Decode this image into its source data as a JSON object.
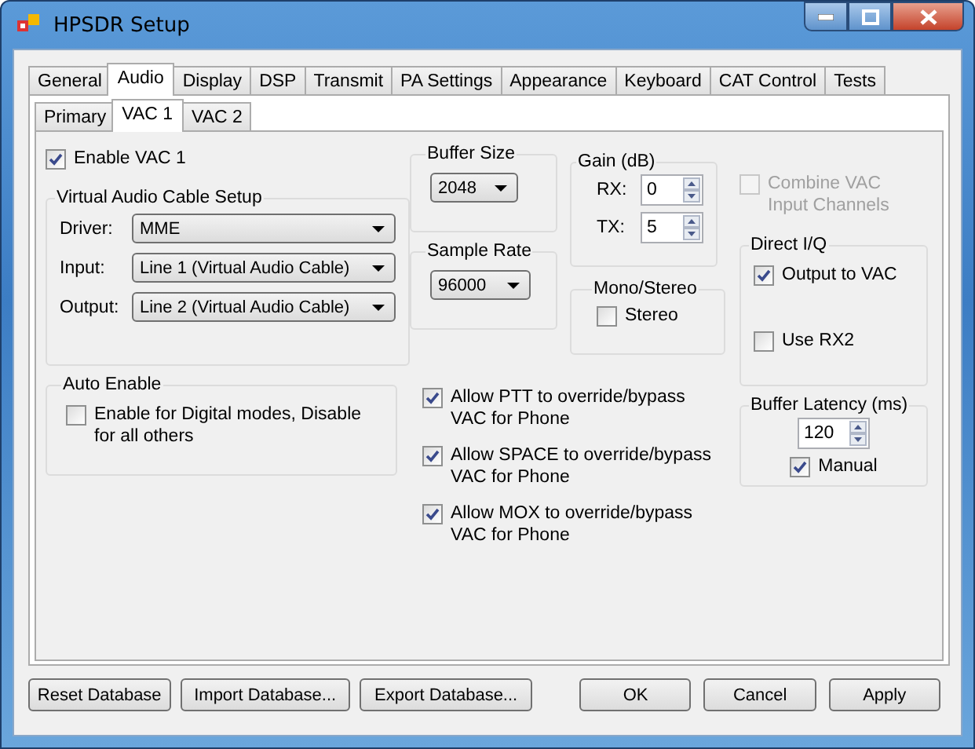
{
  "window": {
    "title": "HPSDR Setup"
  },
  "tabs": [
    {
      "label": "General",
      "selected": false
    },
    {
      "label": "Audio",
      "selected": true
    },
    {
      "label": "Display",
      "selected": false
    },
    {
      "label": "DSP",
      "selected": false
    },
    {
      "label": "Transmit",
      "selected": false
    },
    {
      "label": "PA Settings",
      "selected": false
    },
    {
      "label": "Appearance",
      "selected": false
    },
    {
      "label": "Keyboard",
      "selected": false
    },
    {
      "label": "CAT Control",
      "selected": false
    },
    {
      "label": "Tests",
      "selected": false
    }
  ],
  "subtabs": [
    {
      "label": "Primary",
      "selected": false
    },
    {
      "label": "VAC 1",
      "selected": true
    },
    {
      "label": "VAC 2",
      "selected": false
    }
  ],
  "enable_vac": {
    "label": "Enable VAC 1",
    "checked": true
  },
  "vac_setup": {
    "title": "Virtual Audio Cable Setup",
    "fields": [
      {
        "label": "Driver:",
        "value": "MME"
      },
      {
        "label": "Input:",
        "value": "Line 1 (Virtual Audio Cable)"
      },
      {
        "label": "Output:",
        "value": "Line 2 (Virtual Audio Cable)"
      }
    ]
  },
  "auto_enable": {
    "title": "Auto Enable",
    "checkbox": {
      "label": "Enable for Digital modes, Disable for all others",
      "checked": false
    }
  },
  "buffer_size": {
    "title": "Buffer Size",
    "value": "2048"
  },
  "sample_rate": {
    "title": "Sample Rate",
    "value": "96000"
  },
  "gain": {
    "title": "Gain (dB)",
    "rows": [
      {
        "label": "RX:",
        "value": "0"
      },
      {
        "label": "TX:",
        "value": "5"
      }
    ]
  },
  "mono_stereo": {
    "title": "Mono/Stereo",
    "checkbox": {
      "label": "Stereo",
      "checked": false
    }
  },
  "combine_vac": {
    "label": "Combine VAC Input Channels",
    "checked": false,
    "disabled": true
  },
  "direct_iq": {
    "title": "Direct I/Q",
    "checkboxes": [
      {
        "label": "Output to VAC",
        "checked": true
      },
      {
        "label": "Use RX2",
        "checked": false
      }
    ]
  },
  "allow_options": [
    {
      "label": "Allow PTT to override/bypass VAC for Phone",
      "checked": true
    },
    {
      "label": "Allow SPACE to override/bypass VAC for Phone",
      "checked": true
    },
    {
      "label": "Allow MOX to override/bypass VAC for Phone",
      "checked": true
    }
  ],
  "buffer_latency": {
    "title": "Buffer Latency (ms)",
    "value": "120",
    "manual": {
      "label": "Manual",
      "checked": true
    }
  },
  "buttons": [
    {
      "label": "Reset Database"
    },
    {
      "label": "Import Database..."
    },
    {
      "label": "Export Database..."
    },
    {
      "label": "OK"
    },
    {
      "label": "Cancel"
    },
    {
      "label": "Apply"
    }
  ]
}
